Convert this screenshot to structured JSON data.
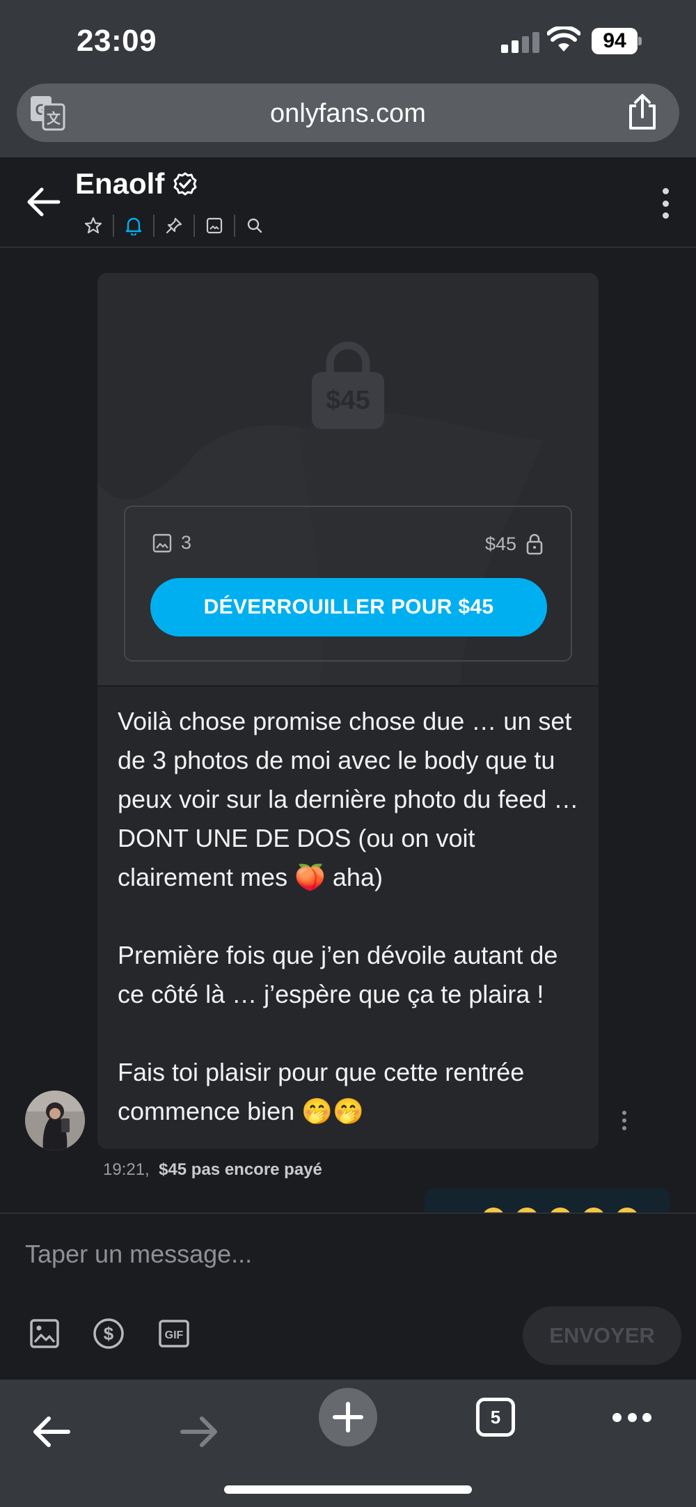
{
  "status_bar": {
    "time": "23:09",
    "battery": "94",
    "icons": [
      "cellular-signal-icon",
      "wifi-icon",
      "battery-icon"
    ]
  },
  "browser": {
    "url": "onlyfans.com",
    "icons": [
      "translate-icon",
      "share-icon"
    ],
    "tabs_count": "5"
  },
  "chat_header": {
    "name": "Enaolf",
    "icons": [
      "back-arrow-icon",
      "verified-badge-icon",
      "star-icon",
      "bell-icon",
      "pin-icon",
      "media-icon",
      "search-icon",
      "kebab-menu-icon"
    ],
    "active_color": "#00aff0"
  },
  "message": {
    "locked_price": "$45",
    "media_count": "3",
    "media_price": "$45",
    "unlock_button": "DÉVERROUILLER POUR $45",
    "text_p1": "Voilà chose promise chose due … un set de 3 photos de moi avec le body que tu peux voir sur la dernière photo du feed … DONT UNE DE DOS (ou on voit clairement mes 🍑 aha)",
    "text_p2": "Première fois que j’en dévoile autant de ce côté là … j’espère que ça te plaira !",
    "text_p3": "Fais toi plaisir pour que cette rentrée commence bien 🤭🤭",
    "time": "19:21,",
    "payment_status": "$45 pas encore payé"
  },
  "composer": {
    "placeholder": "Taper un message...",
    "send_label": "ENVOYER",
    "tools": [
      "image-icon",
      "dollar-icon",
      "gif-icon"
    ]
  },
  "colors": {
    "accent": "#00aff0",
    "background": "#1b1c1f",
    "card": "#26272b",
    "browser_chrome": "#36393d"
  }
}
